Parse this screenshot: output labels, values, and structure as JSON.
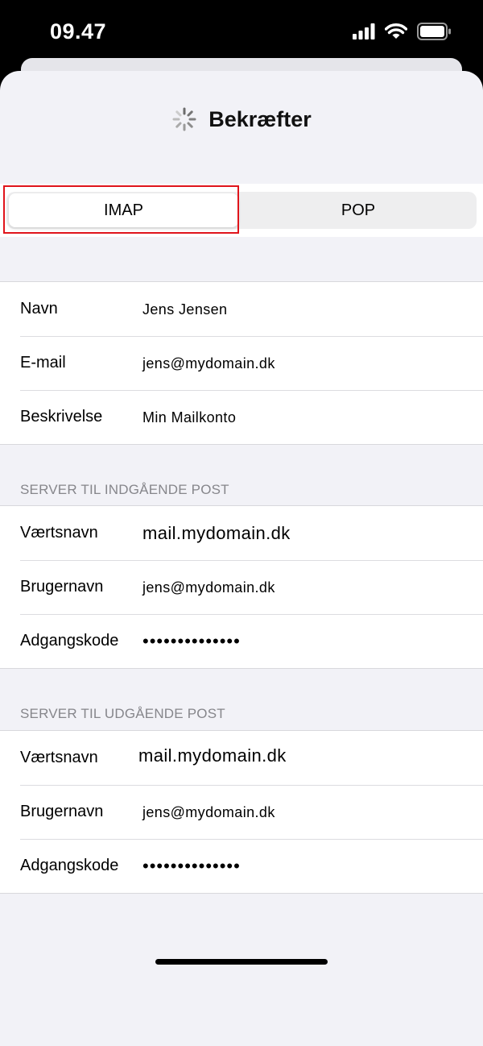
{
  "status_bar": {
    "time": "09.47"
  },
  "header": {
    "title": "Bekræfter"
  },
  "segment": {
    "imap_label": "IMAP",
    "pop_label": "POP",
    "selected": "IMAP"
  },
  "account": {
    "rows": [
      {
        "label": "Navn",
        "value": "Jens Jensen"
      },
      {
        "label": "E-mail",
        "value": "jens@mydomain.dk"
      },
      {
        "label": "Beskrivelse",
        "value": "Min Mailkonto"
      }
    ]
  },
  "incoming": {
    "header": "SERVER TIL INDGÅENDE POST",
    "rows": [
      {
        "label": "Værtsnavn",
        "value": "mail.mydomain.dk"
      },
      {
        "label": "Brugernavn",
        "value": "jens@mydomain.dk"
      },
      {
        "label": "Adgangskode",
        "value": "••••••••••••••"
      }
    ]
  },
  "outgoing": {
    "header": "SERVER TIL UDGÅENDE POST",
    "rows": [
      {
        "label": "Værtsnavn",
        "value": "mail.mydomain.dk"
      },
      {
        "label": "Brugernavn",
        "value": "jens@mydomain.dk"
      },
      {
        "label": "Adgangskode",
        "value": "••••••••••••••"
      }
    ]
  }
}
